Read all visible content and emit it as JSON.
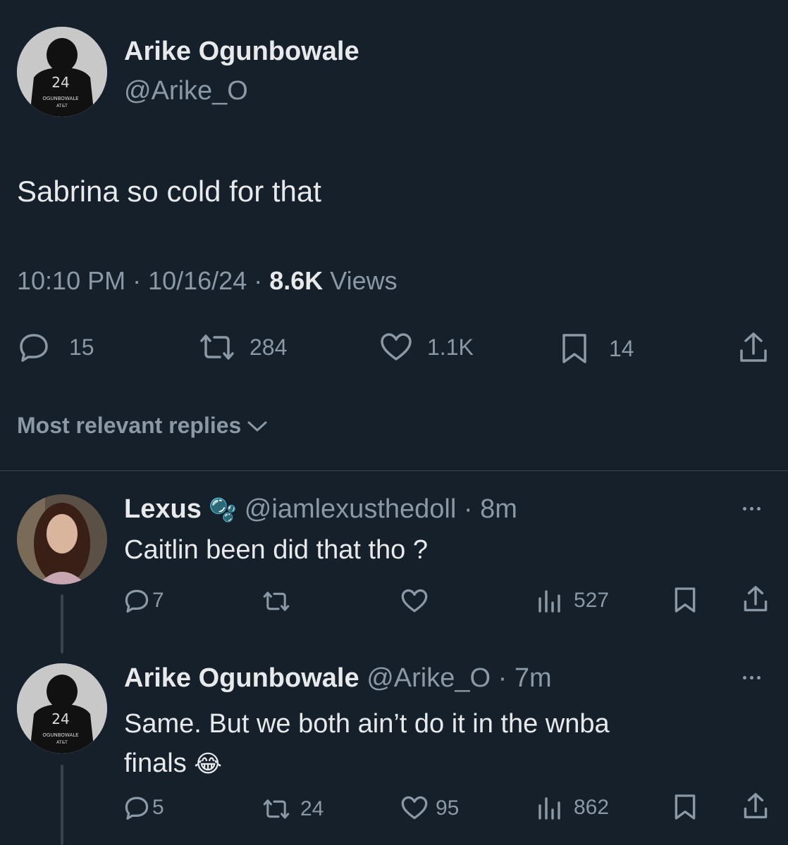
{
  "main_tweet": {
    "author_name": "Arike Ogunbowale",
    "author_handle": "@Arike_O",
    "avatar": {
      "jersey_number": "24",
      "jersey_name": "OGUNBOWALE",
      "sponsor": "AT&T"
    },
    "text": "Sabrina so cold for that",
    "time": "10:10 PM",
    "sep1": " · ",
    "date": "10/16/24",
    "sep2": " · ",
    "views_count": "8.6K",
    "views_label": " Views",
    "stats": {
      "replies": "15",
      "reposts": "284",
      "likes": "1.1K",
      "bookmarks": "14"
    }
  },
  "replies_sort": {
    "label": "Most relevant replies"
  },
  "replies": [
    {
      "author_name": "Lexus",
      "author_emoji": "🫧",
      "author_handle": "@iamlexusthedoll",
      "sep": " · ",
      "age": "8m",
      "text": "Caitlin been did that tho ?",
      "stats": {
        "replies": "7",
        "reposts": "",
        "likes": "",
        "views": "527"
      }
    },
    {
      "author_name": "Arike Ogunbowale",
      "author_handle": "@Arike_O",
      "sep": " · ",
      "age": "7m",
      "avatar": {
        "jersey_number": "24",
        "jersey_name": "OGUNBOWALE",
        "sponsor": "AT&T"
      },
      "text_line1": "Same. But we both ain’t do it in the wnba",
      "text_line2": "finals",
      "text_emoji": "😂",
      "stats": {
        "replies": "5",
        "reposts": "24",
        "likes": "95",
        "views": "862"
      }
    }
  ],
  "colors": {
    "background": "#15202b",
    "text": "#e7e9ea",
    "muted": "#8b98a5",
    "divider": "#38444d"
  }
}
